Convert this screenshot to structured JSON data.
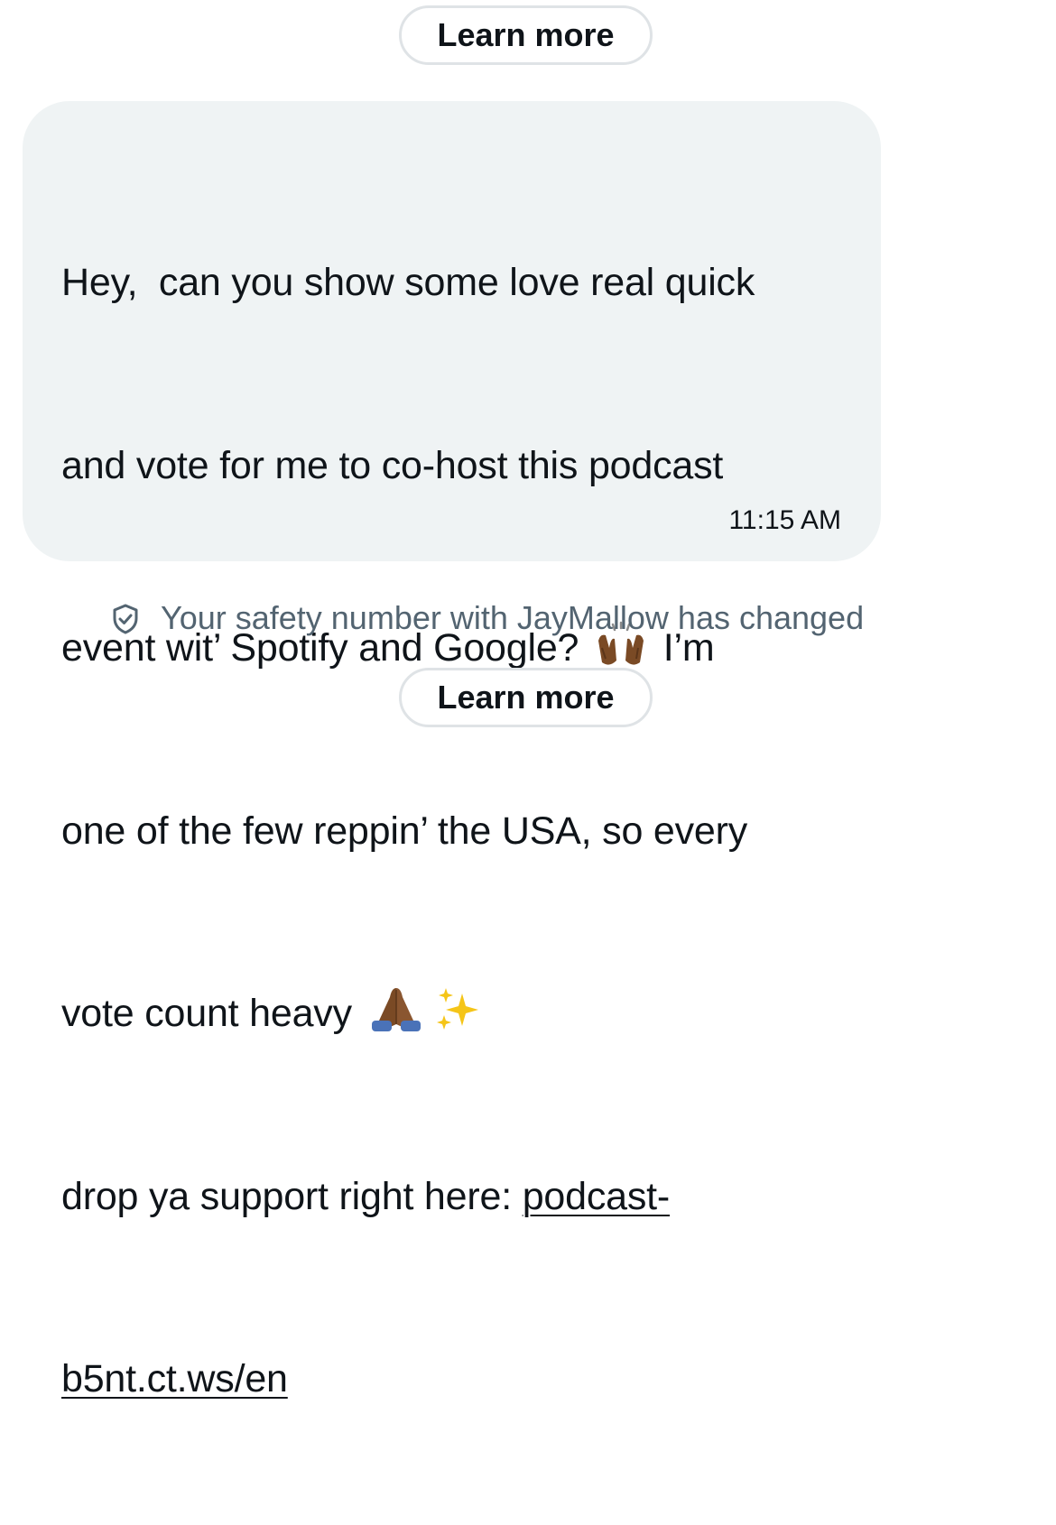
{
  "top_action": {
    "label": "Learn more"
  },
  "message": {
    "lines": [
      "Hey,  can you show some love real quick",
      "and vote for me to co-host this podcast",
      "event wit’ Spotify and Google?",
      "I’m",
      "one of the few reppin’ the USA, so every",
      "vote count heavy",
      "drop ya support right here: ",
      "podcast-",
      "b5nt.ct.ws/en"
    ],
    "emojis": {
      "raising_hands": "raising-hands-icon",
      "folded_hands": "folded-hands-icon",
      "sparkles": "sparkles-icon"
    },
    "timestamp": "11:15 AM"
  },
  "safety_notice": {
    "icon": "shield-check-icon",
    "text": "Your safety number with JayMallow has changed"
  },
  "bottom_action": {
    "label": "Learn more"
  },
  "colors": {
    "bubble_bg": "#eff3f4",
    "button_border": "#dfe3e6",
    "text_primary": "#0f1419",
    "text_secondary": "#536471"
  }
}
